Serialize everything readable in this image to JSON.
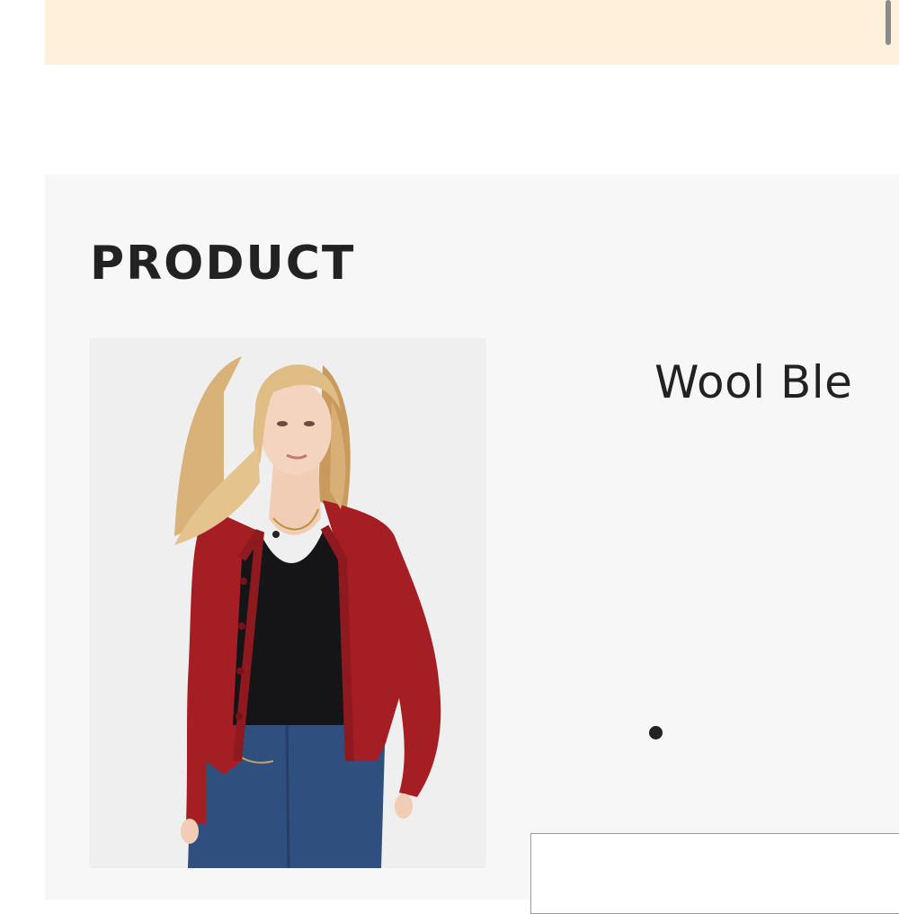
{
  "announcement_bar": {
    "color": "#fff0dc"
  },
  "product_section": {
    "heading": "PRODUCT",
    "background": "#f7f7f8",
    "image": {
      "description_icon": "product-photo-red-cardigan"
    },
    "title": "Wool Ble",
    "carousel": {
      "active_dot_color": "#222222"
    }
  }
}
